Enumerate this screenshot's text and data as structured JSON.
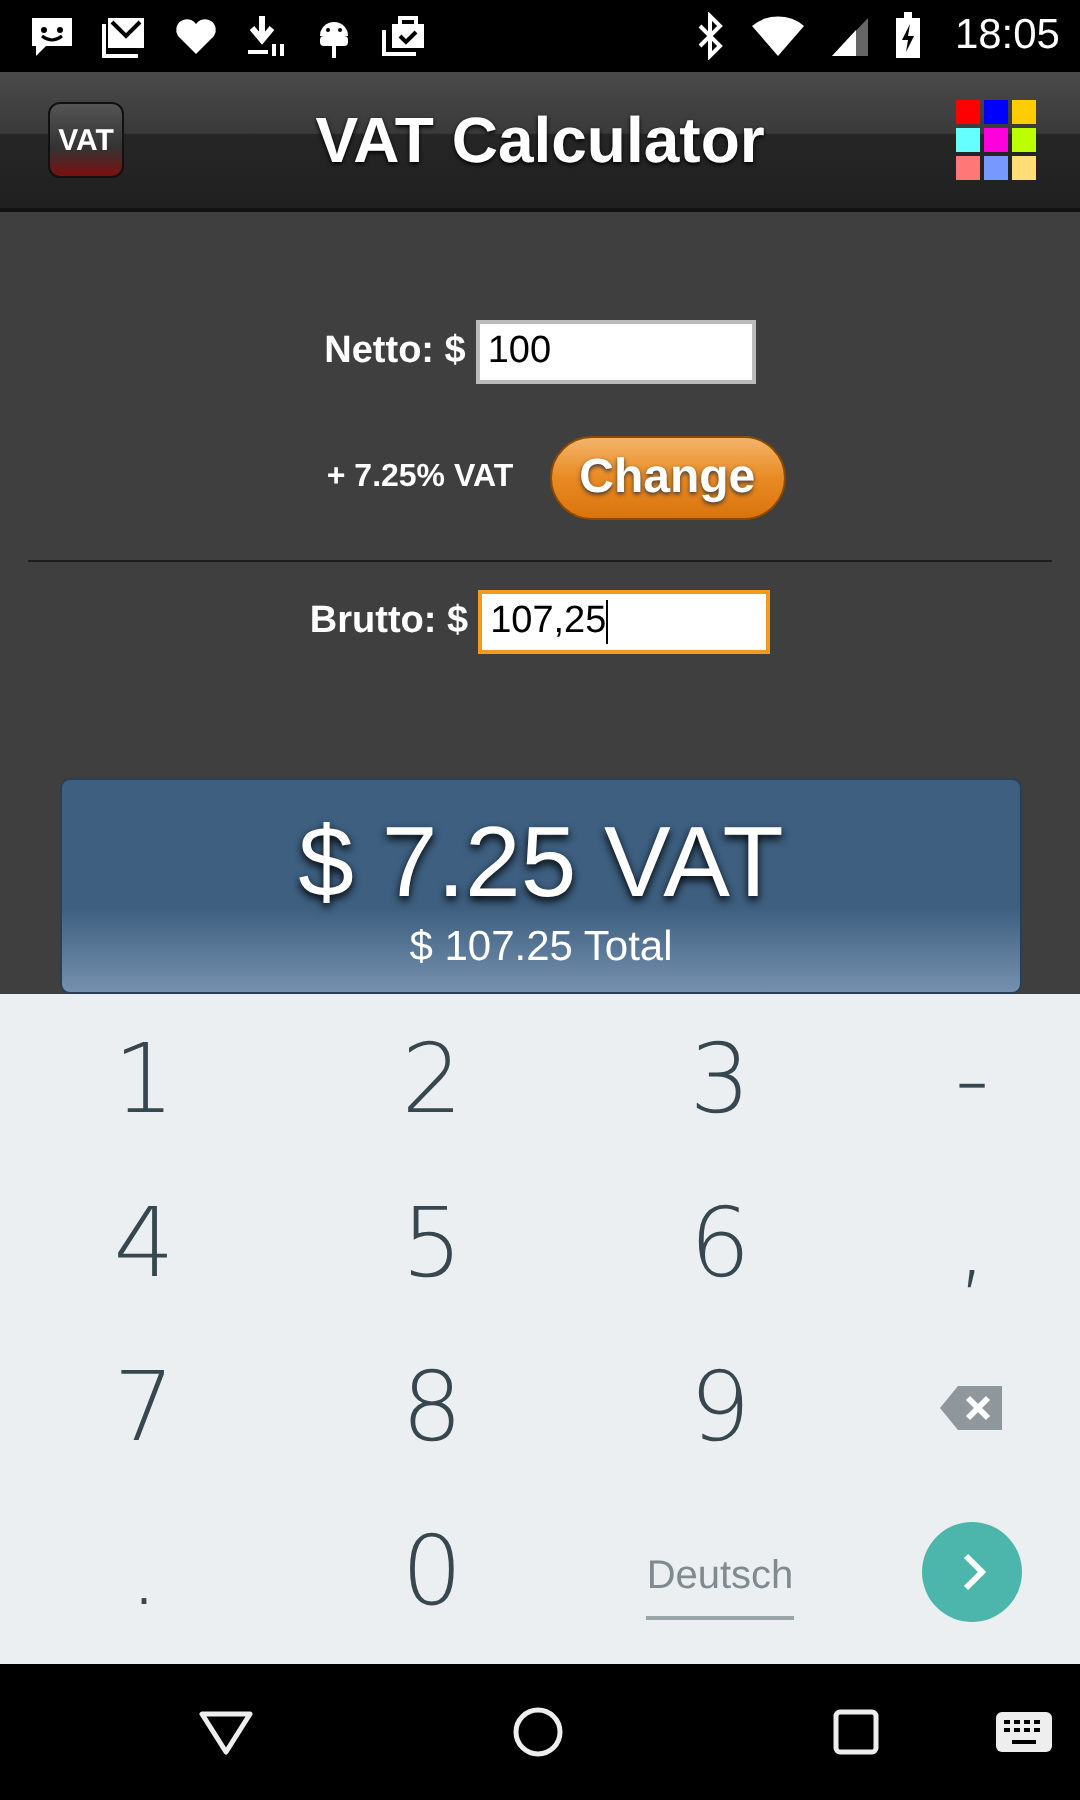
{
  "status_bar": {
    "time": "18:05"
  },
  "app_bar": {
    "logo": "VAT",
    "title": "VAT Calculator"
  },
  "netto": {
    "label": "Netto: $",
    "value": "100",
    "focused": false
  },
  "rate": {
    "text": "+ 7.25% VAT",
    "button": "Change"
  },
  "brutto": {
    "label": "Brutto: $",
    "value": "107,25",
    "focused": true
  },
  "result": {
    "vat": "$ 7.25 VAT",
    "total": "$ 107.25 Total"
  },
  "keyboard": {
    "keys": [
      {
        "kind": "char",
        "label": "1"
      },
      {
        "kind": "char",
        "label": "2"
      },
      {
        "kind": "char",
        "label": "3"
      },
      {
        "kind": "char",
        "label": "-"
      },
      {
        "kind": "char",
        "label": "4"
      },
      {
        "kind": "char",
        "label": "5"
      },
      {
        "kind": "char",
        "label": "6"
      },
      {
        "kind": "char",
        "label": ","
      },
      {
        "kind": "char",
        "label": "7"
      },
      {
        "kind": "char",
        "label": "8"
      },
      {
        "kind": "char",
        "label": "9"
      },
      {
        "kind": "backspace"
      },
      {
        "kind": "char",
        "label": "."
      },
      {
        "kind": "char",
        "label": "0"
      },
      {
        "kind": "language",
        "label": "Deutsch"
      },
      {
        "kind": "enter"
      }
    ]
  }
}
